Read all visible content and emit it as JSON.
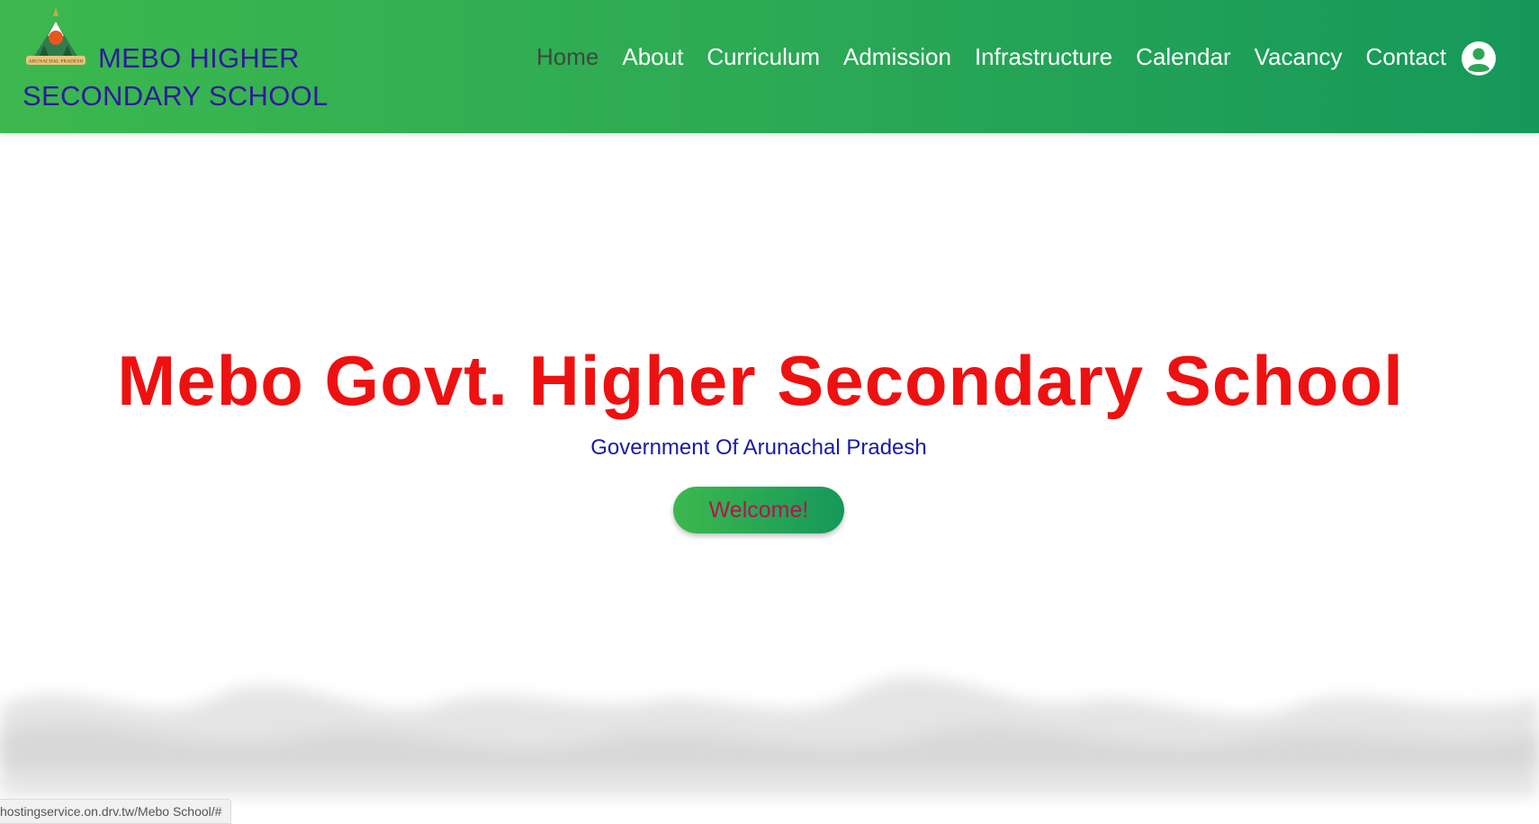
{
  "brand": {
    "name": "MEBO HIGHER SECONDARY SCHOOL",
    "logo_icon": "arunachal-pradesh-emblem-icon",
    "logo_text": "ARUNACHAL PRADESH"
  },
  "nav": {
    "items": [
      {
        "label": "Home",
        "active": true
      },
      {
        "label": "About"
      },
      {
        "label": "Curriculum"
      },
      {
        "label": "Admission"
      },
      {
        "label": "Infrastructure"
      },
      {
        "label": "Calendar"
      },
      {
        "label": "Vacancy"
      },
      {
        "label": "Contact"
      }
    ],
    "user_icon": "user-circle-icon"
  },
  "hero": {
    "title": "Mebo Govt. Higher Secondary School",
    "subtitle": "Government Of Arunachal Pradesh",
    "button_label": "Welcome!"
  },
  "status_bar": {
    "url": "hostingservice.on.drv.tw/Mebo School/#"
  },
  "colors": {
    "nav_gradient_start": "#3cb84e",
    "nav_gradient_end": "#15985a",
    "brand_text": "#2e1b9c",
    "hero_title": "#ee1111",
    "hero_subtitle": "#1a1aa8",
    "button_text": "#b5124f"
  }
}
